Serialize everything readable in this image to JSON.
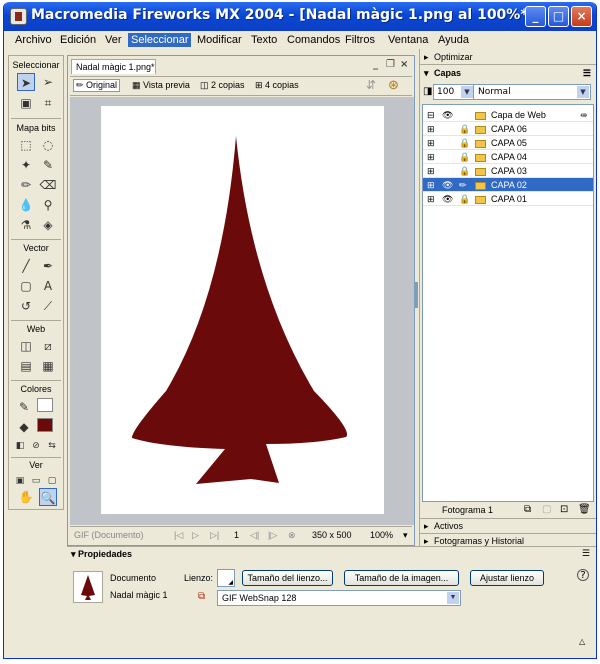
{
  "window": {
    "title": "Macromedia Fireworks MX 2004 - [Nadal màgic 1.png al 100%*]",
    "controls": [
      "_",
      "□",
      "×"
    ]
  },
  "menu": [
    "Archivo",
    "Edición",
    "Ver",
    "Seleccionar",
    "Modificar",
    "Texto",
    "Comandos",
    "Filtros",
    "Ventana",
    "Ayuda"
  ],
  "tools": {
    "sections": [
      "Seleccionar",
      "Mapa bits",
      "Vector",
      "Web",
      "Colores",
      "Ver"
    ]
  },
  "document": {
    "tab": "Nadal màgic 1.png*",
    "views": [
      "Original",
      "Vista previa",
      "2 copias",
      "4 copias"
    ],
    "status": {
      "format": "GIF (Documento)",
      "frame": "1",
      "size": "350 x 500",
      "zoom": "100%"
    },
    "tree_color": "#6b0a0a"
  },
  "panels": {
    "optimizar": "Optimizar",
    "capas": "Capas",
    "opacity": "100",
    "blend": "Normal",
    "layers": [
      {
        "name": "Capa de Web",
        "selected": false
      },
      {
        "name": "CAPA 06",
        "selected": false
      },
      {
        "name": "CAPA 05",
        "selected": false
      },
      {
        "name": "CAPA 04",
        "selected": false
      },
      {
        "name": "CAPA 03",
        "selected": false
      },
      {
        "name": "CAPA 02",
        "selected": true
      },
      {
        "name": "CAPA 01",
        "selected": false
      }
    ],
    "frame_label": "Fotograma 1",
    "activos": "Activos",
    "fotogramas": "Fotogramas y Historial"
  },
  "properties": {
    "header": "Propiedades",
    "doc_label": "Documento",
    "doc_name": "Nadal màgic 1",
    "lienzo": "Lienzo:",
    "btn_canvas_size": "Tamaño del lienzo...",
    "btn_image_size": "Tamaño de la imagen...",
    "btn_fit_canvas": "Ajustar lienzo",
    "optimize_setting": "GIF WebSnap 128",
    "help": "?"
  }
}
